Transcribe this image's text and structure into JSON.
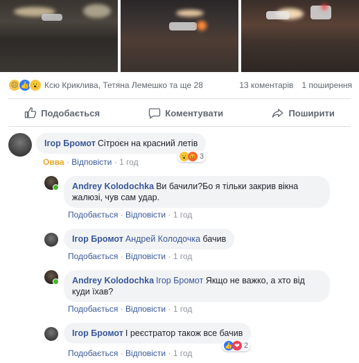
{
  "post": {
    "reactions_summary": "Ксю Криклива, Тетяна Лемешко та ще 28",
    "comments_count": "13 коментарів",
    "shares_count": "1 поширення",
    "reaction_icons": [
      "sad-icon",
      "like-icon",
      "wow-icon"
    ]
  },
  "actions": {
    "like": "Подобається",
    "comment": "Коментувати",
    "share": "Поширити"
  },
  "comments": [
    {
      "author": "Ігор Бромот",
      "mention": "",
      "text": "Сітроєн на красний летів",
      "reaction_label": "Овва",
      "reply": "Відповісти",
      "time": "1 год",
      "reaction_count": "3"
    },
    {
      "author": "Andrey Kolodochka",
      "mention": "",
      "text": "Ви бачили?Бо я тільки закрив вікна жалюзі, чув сам удар.",
      "like": "Подобається",
      "reply": "Відповісти",
      "time": "1 год"
    },
    {
      "author": "Ігор Бромот",
      "mention": "Андрей Колодочка",
      "text": "бачив",
      "like": "Подобається",
      "reply": "Відповісти",
      "time": "1 год"
    },
    {
      "author": "Andrey Kolodochka",
      "mention": "Ігор Бромот",
      "text": "Якщо не важко, а хто від куди їхав?",
      "like": "Подобається",
      "reply": "Відповісти",
      "time": "1 год"
    },
    {
      "author": "Ігор Бромот",
      "mention": "",
      "text": "І реєстратор також все бачив",
      "like": "Подобається",
      "reply": "Відповісти",
      "time": "1 год",
      "reaction_count": "2"
    }
  ],
  "separator": "·"
}
